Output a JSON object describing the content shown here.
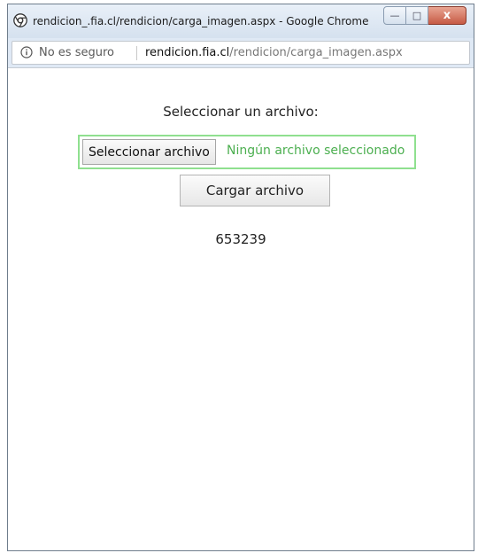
{
  "window": {
    "title": "rendicion_.fia.cl/rendicion/carga_imagen.aspx - Google Chrome",
    "controls": {
      "minimize": "—",
      "maximize": "□",
      "close": "x"
    }
  },
  "addressbar": {
    "security_label": "No es seguro",
    "url_host": "rendicion.fia.cl",
    "url_path": "/rendicion/carga_imagen.aspx"
  },
  "page": {
    "prompt": "Seleccionar un archivo:",
    "file_input": {
      "button_label": "Seleccionar archivo",
      "status": "Ningún archivo seleccionado"
    },
    "upload_button_label": "Cargar archivo",
    "code": "653239"
  },
  "colors": {
    "focus_border": "#8fe08f",
    "status_text": "#4caf50",
    "close_button": "#c65a45"
  }
}
